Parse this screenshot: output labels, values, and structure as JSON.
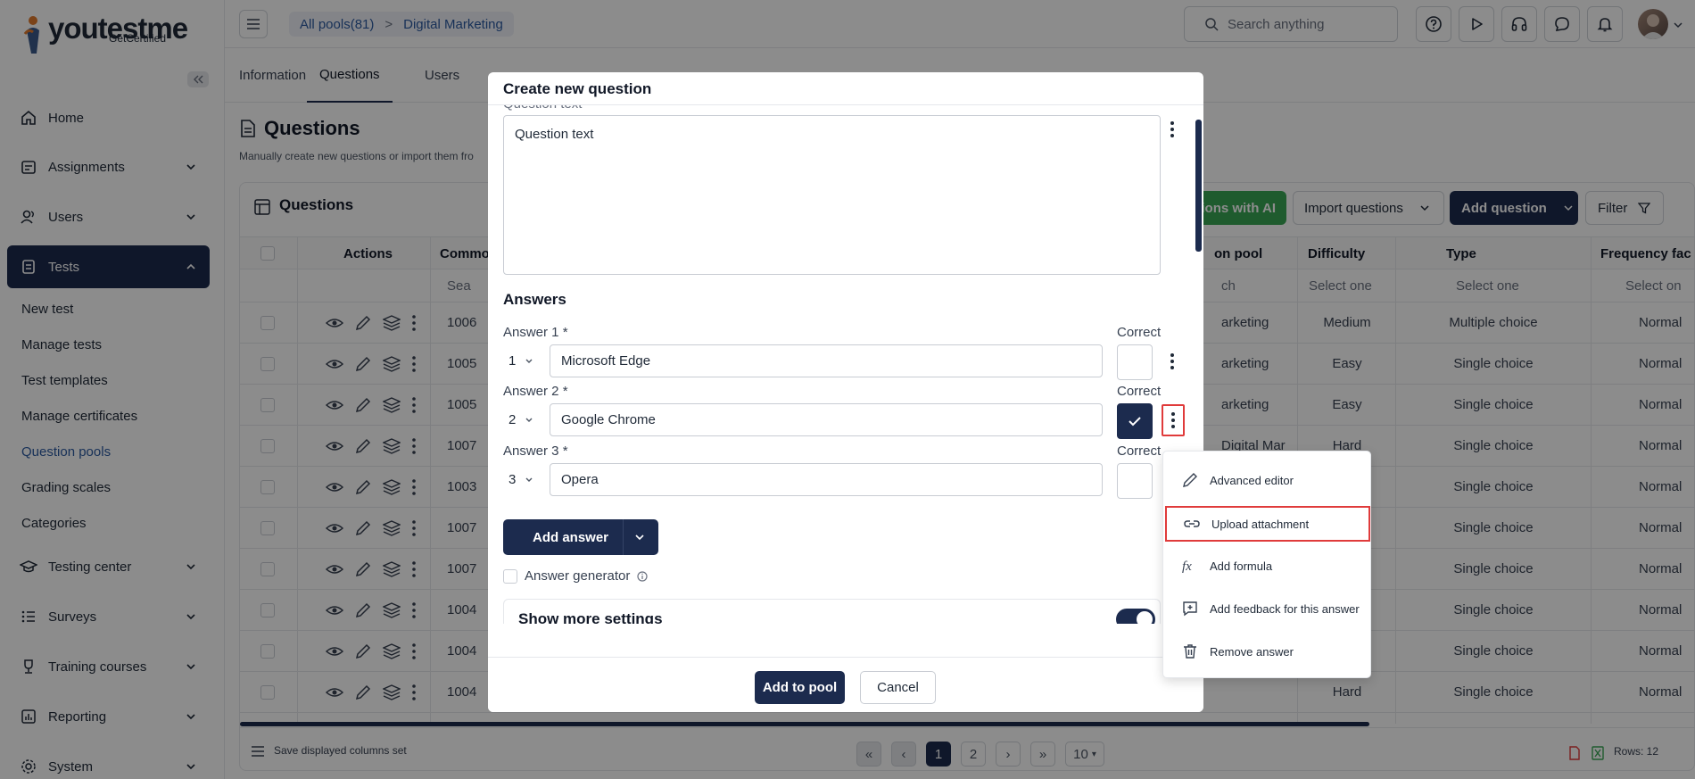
{
  "app": {
    "logo": "youtestme",
    "logo_sub": "GetCertified"
  },
  "sidebar": {
    "items": [
      {
        "label": "Home"
      },
      {
        "label": "Assignments"
      },
      {
        "label": "Users"
      },
      {
        "label": "Tests"
      },
      {
        "label": "Testing center"
      },
      {
        "label": "Surveys"
      },
      {
        "label": "Training courses"
      },
      {
        "label": "Reporting"
      },
      {
        "label": "System"
      }
    ],
    "sub_items": [
      {
        "label": "New test"
      },
      {
        "label": "Manage tests"
      },
      {
        "label": "Test templates"
      },
      {
        "label": "Manage certificates"
      },
      {
        "label": "Question pools"
      },
      {
        "label": "Grading scales"
      },
      {
        "label": "Categories"
      }
    ]
  },
  "header": {
    "breadcrumb": [
      "All pools(81)",
      ">",
      "Digital Marketing"
    ],
    "search_placeholder": "Search anything"
  },
  "page": {
    "tabs": [
      "Information",
      "Questions",
      "Users"
    ],
    "title": "Questions",
    "subtitle": "Manually create new questions or import them fro",
    "table_title": "Questions",
    "buttons": {
      "ai": "tions with AI",
      "import": "Import questions",
      "add": "Add question",
      "filter": "Filter"
    },
    "columns": {
      "actions": "Actions",
      "common": "Commo",
      "pool": "on pool",
      "difficulty": "Difficulty",
      "type": "Type",
      "frequency": "Frequency fac"
    },
    "filters": {
      "search": "Sea",
      "pool_search": "ch",
      "difficulty": "Select one",
      "type": "Select one",
      "frequency": "Select on"
    },
    "rows": [
      {
        "id": "1006",
        "pool": "arketing",
        "difficulty": "Medium",
        "type": "Multiple choice",
        "freq": "Normal"
      },
      {
        "id": "1005",
        "pool": "arketing",
        "difficulty": "Easy",
        "type": "Single choice",
        "freq": "Normal"
      },
      {
        "id": "1005",
        "pool": "arketing",
        "difficulty": "Easy",
        "type": "Single choice",
        "freq": "Normal"
      },
      {
        "id": "1007",
        "pool": "Digital Mar",
        "difficulty": "Hard",
        "type": "Single choice",
        "freq": "Normal"
      },
      {
        "id": "1003",
        "pool": "",
        "difficulty": "",
        "type": "Single choice",
        "freq": "Normal"
      },
      {
        "id": "1007",
        "pool": "",
        "difficulty": "",
        "type": "Single choice",
        "freq": "Normal"
      },
      {
        "id": "1007",
        "pool": "",
        "difficulty": "",
        "type": "Single choice",
        "freq": "Normal"
      },
      {
        "id": "1004",
        "pool": "",
        "difficulty": "",
        "type": "Single choice",
        "freq": "Normal"
      },
      {
        "id": "1004",
        "pool": "",
        "difficulty": "",
        "type": "Single choice",
        "freq": "Normal"
      },
      {
        "id": "1004",
        "pool": "",
        "difficulty": "Hard",
        "type": "Single choice",
        "freq": "Normal"
      }
    ],
    "footer": {
      "save_cols": "Save displayed columns set",
      "pages": [
        "1",
        "2"
      ],
      "page_size": "10",
      "rows": "Rows: 12"
    }
  },
  "modal": {
    "title": "Create new question",
    "question_label": "Question text",
    "question_text": "Question text",
    "answers_title": "Answers",
    "answers": [
      {
        "label": "Answer 1 *",
        "num": "1",
        "value": "Microsoft Edge",
        "correct_label": "Correct",
        "correct": false
      },
      {
        "label": "Answer 2 *",
        "num": "2",
        "value": "Google Chrome",
        "correct_label": "Correct",
        "correct": true
      },
      {
        "label": "Answer 3 *",
        "num": "3",
        "value": "Opera",
        "correct_label": "Correct",
        "correct": false
      }
    ],
    "add_answer": "Add answer",
    "answer_generator": "Answer generator",
    "show_more": "Show more settings",
    "add_to_pool": "Add to pool",
    "cancel": "Cancel"
  },
  "context_menu": {
    "items": [
      {
        "label": "Advanced editor",
        "icon": "pencil-icon"
      },
      {
        "label": "Upload attachment",
        "icon": "link-icon"
      },
      {
        "label": "Add formula",
        "icon": "fx-icon"
      },
      {
        "label": "Add feedback for this answer",
        "icon": "feedback-icon"
      },
      {
        "label": "Remove answer",
        "icon": "trash-icon"
      }
    ]
  },
  "colors": {
    "primary": "#1c2b4e",
    "link": "#2c5aa0",
    "ai_green": "#3aa655",
    "highlight": "#e03b3b"
  }
}
